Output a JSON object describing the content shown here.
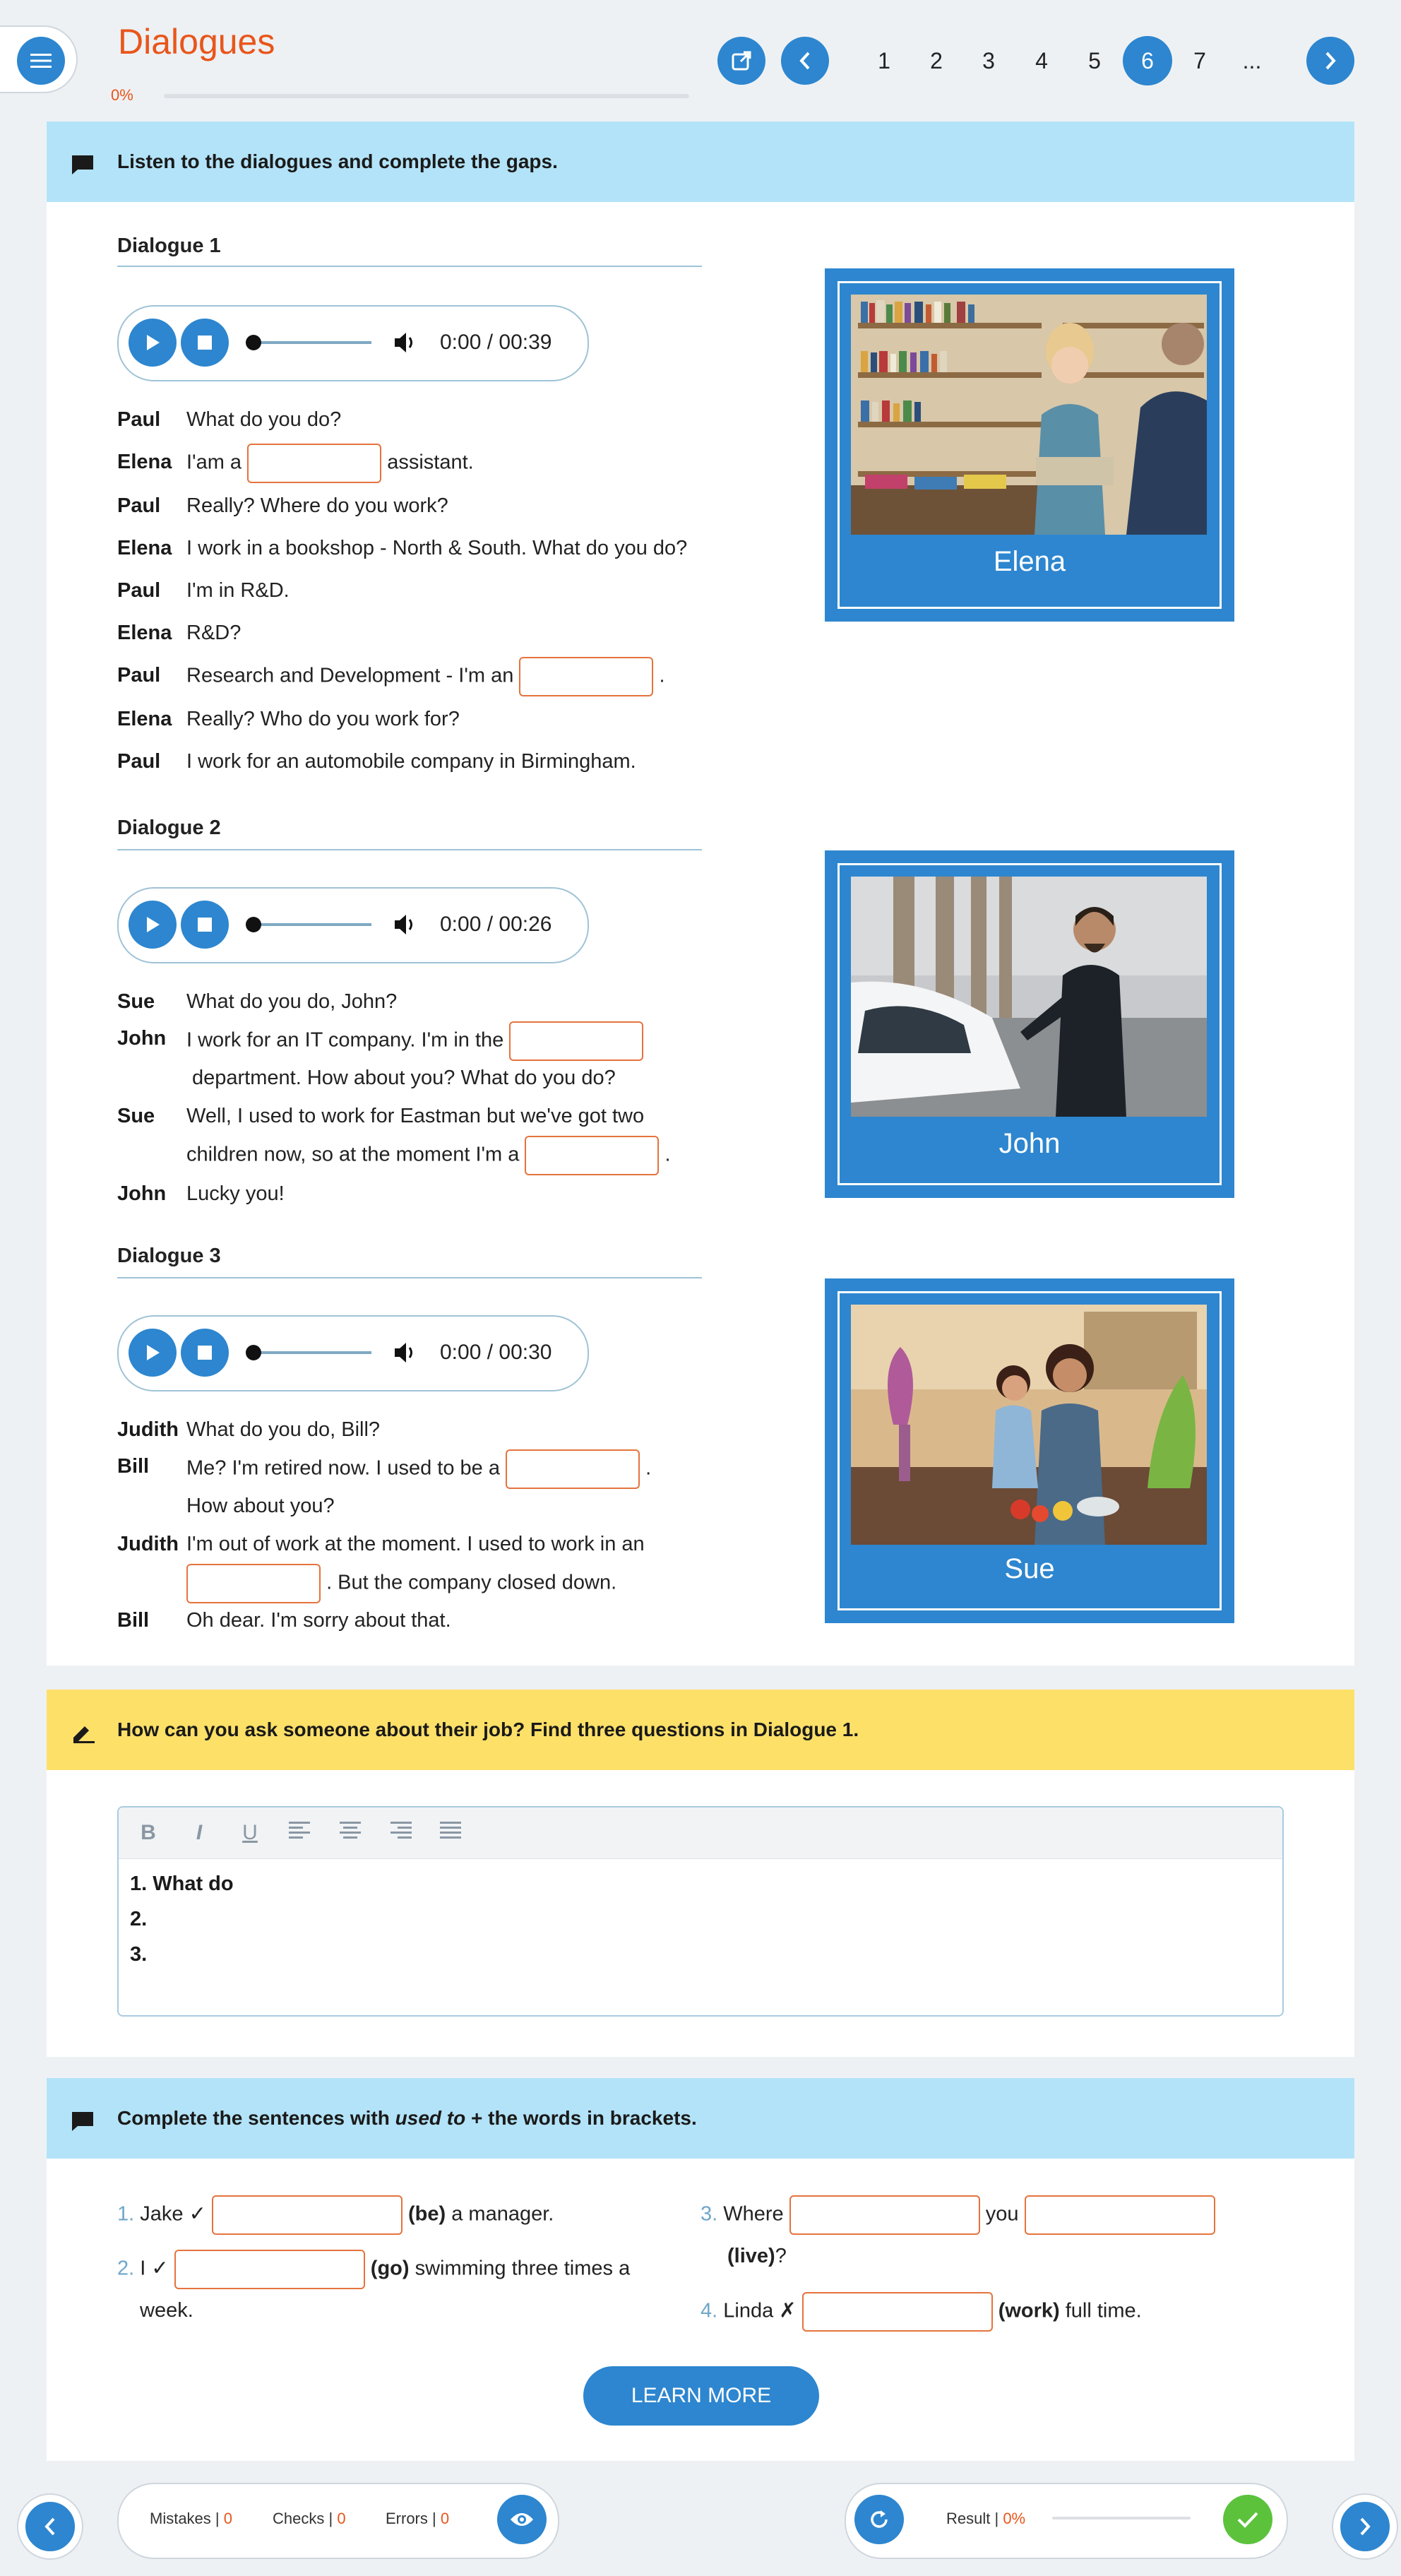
{
  "header": {
    "title": "Dialogues",
    "progress": "0%",
    "pages": [
      "1",
      "2",
      "3",
      "4",
      "5",
      "6",
      "7",
      "..."
    ],
    "active_page": "6"
  },
  "section1": {
    "instruction": "Listen to the dialogues and complete the gaps.",
    "dialogues": [
      {
        "title": "Dialogue 1",
        "time": "0:00 / 00:39",
        "picture_label": "Elena",
        "lines": [
          {
            "speaker": "Paul",
            "text": "What do you do?"
          },
          {
            "speaker": "Elena",
            "before": "I'am a",
            "after": "assistant."
          },
          {
            "speaker": "Paul",
            "text": "Really? Where do you work?"
          },
          {
            "speaker": "Elena",
            "text": "I work in a bookshop - North & South. What do you do?"
          },
          {
            "speaker": "Paul",
            "text": "I'm in R&D."
          },
          {
            "speaker": "Elena",
            "text": "R&D?"
          },
          {
            "speaker": "Paul",
            "before": "Research and Development - I'm an",
            "after": "."
          },
          {
            "speaker": "Elena",
            "text": "Really? Who do you work for?"
          },
          {
            "speaker": "Paul",
            "text": "I work for an automobile company in Birmingham."
          }
        ]
      },
      {
        "title": "Dialogue 2",
        "time": "0:00 / 00:26",
        "picture_label": "John",
        "lines": [
          {
            "speaker": "Sue",
            "text": "What do you do, John?"
          },
          {
            "speaker": "John",
            "before": "I work for an IT company. I'm in the",
            "after": "",
            "cont": "department. How about you? What do you do?"
          },
          {
            "speaker": "Sue",
            "text": "Well, I used to work for Eastman but we've got two",
            "before2": "children now, so at the moment I'm a",
            "after2": "."
          },
          {
            "speaker": "John",
            "text": "Lucky you!"
          }
        ]
      },
      {
        "title": "Dialogue 3",
        "time": "0:00 / 00:30",
        "picture_label": "Sue",
        "lines": [
          {
            "speaker": "Judith",
            "text": "What do you do, Bill?"
          },
          {
            "speaker": "Bill",
            "before": "Me? I'm retired now. I used to be a",
            "after": ".",
            "cont": "How about you?"
          },
          {
            "speaker": "Judith",
            "text": "I'm out of work at the moment. I used to work in an",
            "after2": ". But the company closed down."
          },
          {
            "speaker": "Bill",
            "text": "Oh dear. I'm sorry about that."
          }
        ]
      }
    ]
  },
  "section2": {
    "instruction": "How can you ask someone about their job? Find three questions in Dialogue 1.",
    "toolbar": [
      "B",
      "I",
      "U",
      "align-left",
      "align-center",
      "align-right",
      "align-justify"
    ],
    "editor_lines": [
      "1. What do",
      "2.",
      "3."
    ]
  },
  "section3": {
    "instruction_pre": "Complete the sentences with ",
    "instruction_em": "used to",
    "instruction_post": " + the words in brackets.",
    "items": {
      "q1": {
        "num": "1.",
        "pre": "Jake ✓",
        "word": "(be)",
        "post": "a manager."
      },
      "q2": {
        "num": "2.",
        "pre": "I ✓",
        "word": "(go)",
        "post": "swimming three times a",
        "cont": "week."
      },
      "q3": {
        "num": "3.",
        "pre": "Where",
        "mid": "you",
        "word": "(live)",
        "post": "?"
      },
      "q4": {
        "num": "4.",
        "pre": "Linda ✗",
        "word": "(work)",
        "post": "full time."
      }
    },
    "button": "LEARN MORE"
  },
  "footer": {
    "mistakes_label": "Mistakes |",
    "mistakes": "0",
    "checks_label": "Checks |",
    "checks": "0",
    "errors_label": "Errors |",
    "errors": "0",
    "result_label": "Result |",
    "result": "0%"
  },
  "colors": {
    "accent": "#2d86cf",
    "orange": "#e8561b",
    "blue_banner": "#b3e3f8",
    "yellow_banner": "#fde068",
    "green": "#5cc23c"
  }
}
